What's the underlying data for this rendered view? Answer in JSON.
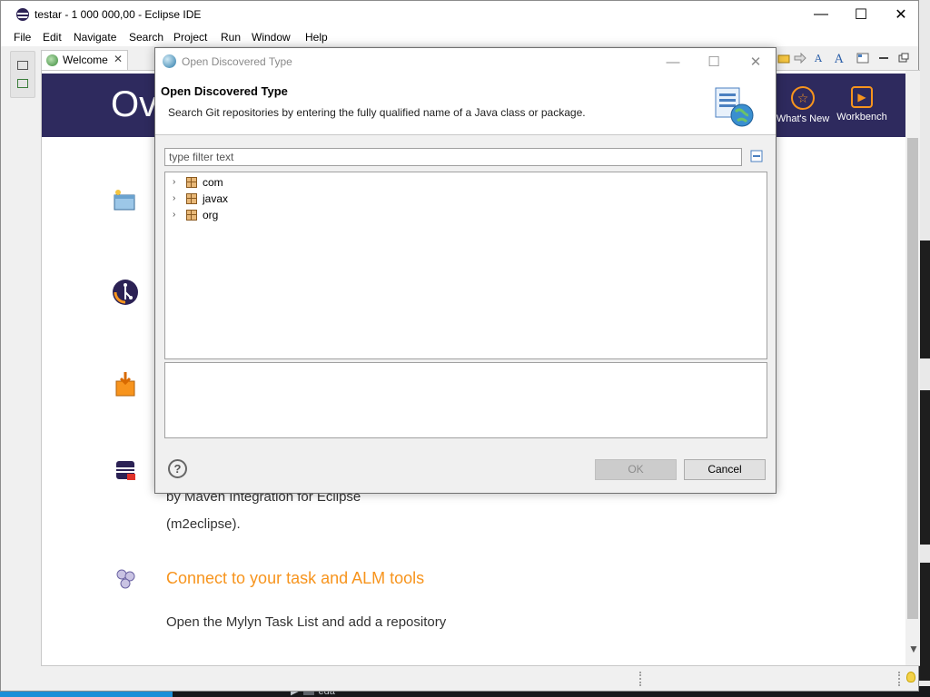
{
  "window": {
    "title": "testar - 1 000 000,00 - Eclipse IDE",
    "minimize": "—",
    "maximize": "☐",
    "close": "✕"
  },
  "menu": [
    "File",
    "Edit",
    "Navigate",
    "Search",
    "Project",
    "Run",
    "Window",
    "Help"
  ],
  "welcome": {
    "tab_label": "Welcome",
    "tab_close": "✕",
    "banner_title": "Ov",
    "whats_new": "What's New",
    "workbench": "Workbench",
    "maven_desc_line2": "by Maven Integration for Eclipse",
    "maven_desc_line3": "(m2eclipse).",
    "connect_title": "Connect to your task and ALM tools",
    "connect_desc": "Open the Mylyn Task List and add a repository"
  },
  "dialog": {
    "title": "Open Discovered Type",
    "header_title": "Open Discovered Type",
    "header_desc": "Search Git repositories by entering the fully qualified name of a Java class or package.",
    "filter_placeholder": "type filter text",
    "tree": [
      "com",
      "javax",
      "org"
    ],
    "help": "?",
    "ok": "OK",
    "cancel": "Cancel",
    "minimize": "—",
    "maximize": "☐",
    "close": "✕"
  },
  "taskbar": {
    "item": "eda"
  },
  "colors": {
    "accent": "#f7941d",
    "banner": "#2e2a5e"
  }
}
